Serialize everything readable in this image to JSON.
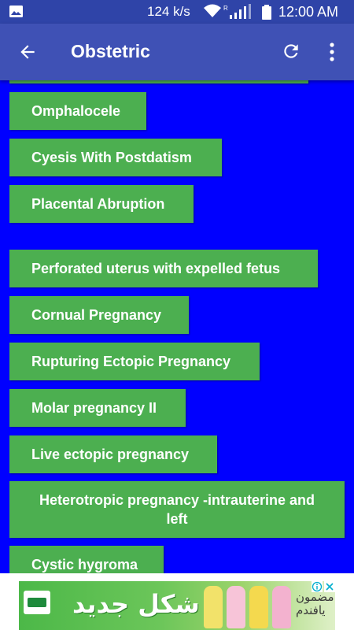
{
  "status_bar": {
    "image_icon": "image-icon",
    "network_speed": "124 k/s",
    "wifi_icon": "wifi-icon",
    "signal_icon": "signal-icon",
    "battery_icon": "battery-icon",
    "time": "12:00 AM"
  },
  "app_bar": {
    "back_icon": "arrow-back-icon",
    "title": "Obstetric",
    "refresh_icon": "refresh-icon",
    "more_icon": "more-vertical-icon"
  },
  "list": {
    "items": [
      {
        "label": ""
      },
      {
        "label": "Omphalocele"
      },
      {
        "label": "Cyesis With Postdatism"
      },
      {
        "label": "Placental Abruption"
      },
      {
        "label": "Perforated uterus with expelled fetus"
      },
      {
        "label": "Cornual Pregnancy"
      },
      {
        "label": "Rupturing Ectopic Pregnancy"
      },
      {
        "label": "Molar pregnancy II"
      },
      {
        "label": "Live ectopic pregnancy"
      },
      {
        "label": "Heterotropic pregnancy -intrauterine and left"
      },
      {
        "label": "Cystic hygroma"
      }
    ]
  },
  "ad_banner": {
    "headline": "شكل جديد",
    "tagline": "مضمون يافندم",
    "adchoices_icon": "adchoices-icon",
    "close_icon": "close-icon"
  },
  "colors": {
    "status_bar": "#2f44a8",
    "app_bar": "#3f51b5",
    "background": "#0000ff",
    "button": "#4caf50",
    "button_text": "#ffffff"
  }
}
